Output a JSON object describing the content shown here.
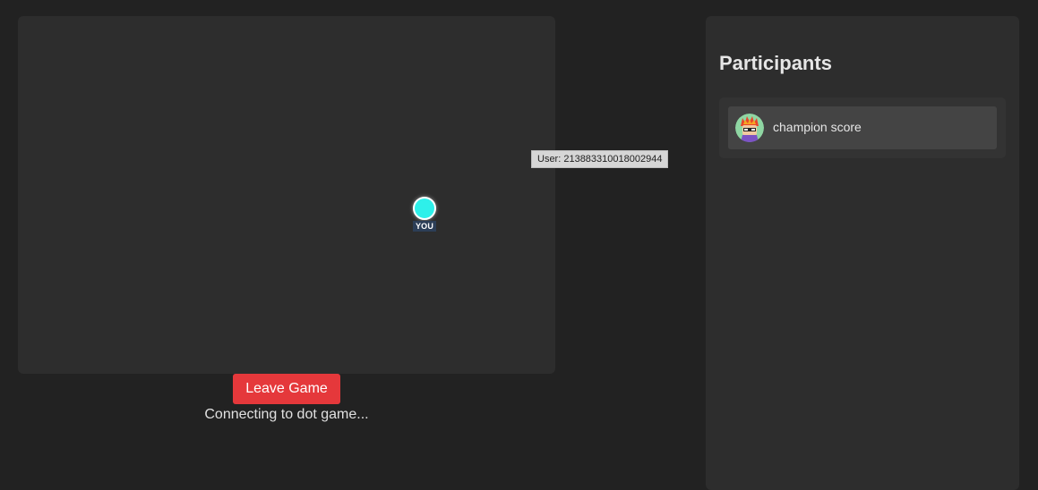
{
  "game": {
    "player_label": "YOU",
    "user_tooltip": "User: 213883310018002944",
    "leave_label": "Leave Game",
    "status": "Connecting to dot game..."
  },
  "participants": {
    "title": "Participants",
    "items": [
      {
        "name": "champion score",
        "avatar": "red-haired-character-avatar"
      }
    ]
  },
  "colors": {
    "background": "#222222",
    "panel": "#2d2d2d",
    "player_dot": "#2ef0ea",
    "leave_button": "#e5383b"
  }
}
